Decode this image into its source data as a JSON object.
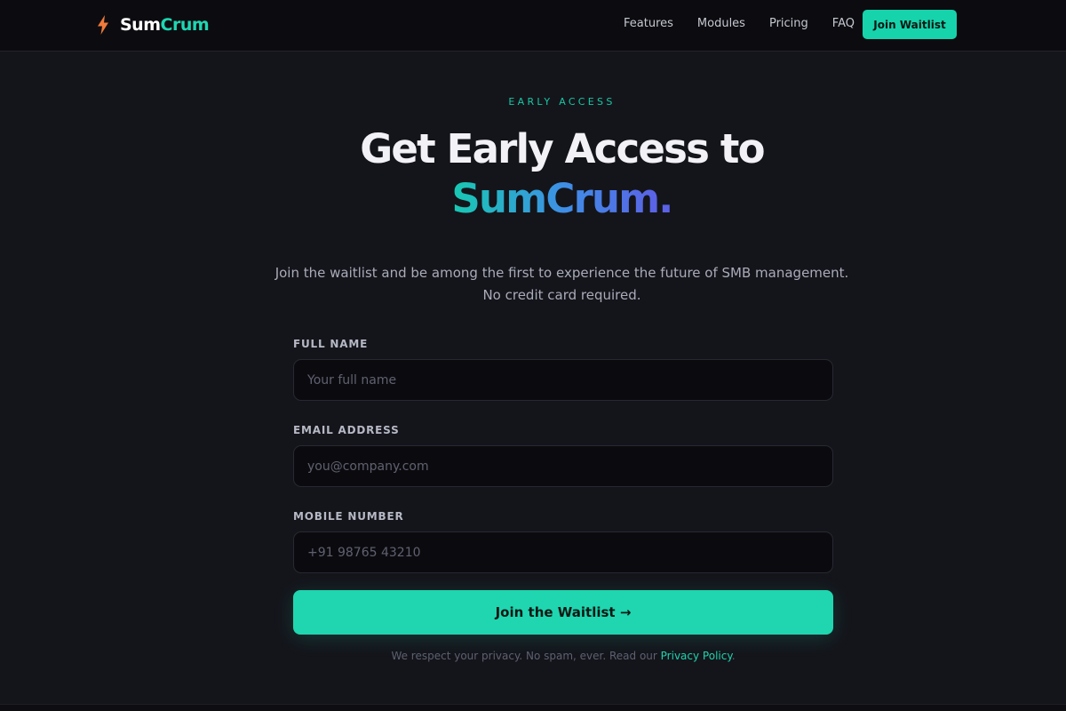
{
  "nav": {
    "brand_a": "Sum",
    "brand_b": "Crum",
    "links": [
      "Features",
      "Modules",
      "Pricing",
      "FAQ"
    ],
    "cta": "Join Waitlist",
    "logo_icon": "lightning-bolt-icon"
  },
  "hero": {
    "eyebrow": "EARLY ACCESS",
    "headline_line1": "Get Early Access to",
    "headline_brand": "SumCrum",
    "headline_dot": ".",
    "sub_line1": "Join the waitlist and be among the first to experience the future of SMB management.",
    "sub_line2": "No credit card required."
  },
  "form": {
    "name_label": "FULL NAME",
    "name_placeholder": "Your full name",
    "email_label": "EMAIL ADDRESS",
    "email_placeholder": "you@company.com",
    "mobile_label": "MOBILE NUMBER",
    "mobile_placeholder": "+91 98765 43210",
    "submit": "Join the Waitlist →",
    "privacy_text": "We respect your privacy. No spam, ever. Read our",
    "privacy_link": "Privacy Policy",
    "privacy_end": "."
  },
  "colors": {
    "accent": "#1fd6b0",
    "background": "#14151b",
    "navbar": "#0c0c10",
    "bolt": "#f07a3a"
  }
}
